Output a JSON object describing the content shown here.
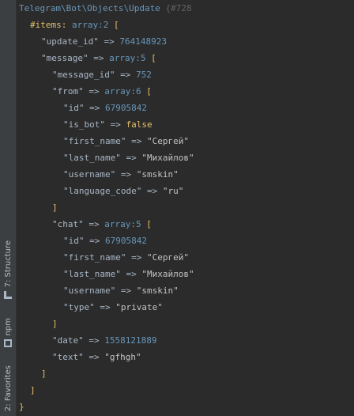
{
  "sidebar": {
    "structure": "7: Structure",
    "npm": "npm",
    "favorites": "2: Favorites"
  },
  "dump": {
    "class_name": "Telegram\\Bot\\Objects\\Update",
    "object_ref": "{#728",
    "items_label": "#items:",
    "items_type": "array:2",
    "update_id_key": "\"update_id\"",
    "update_id_val": "764148923",
    "message_key": "\"message\"",
    "message_type": "array:5",
    "message_id_key": "\"message_id\"",
    "message_id_val": "752",
    "from_key": "\"from\"",
    "from_type": "array:6",
    "from_id_key": "\"id\"",
    "from_id_val": "67905842",
    "is_bot_key": "\"is_bot\"",
    "is_bot_val": "false",
    "from_first_name_key": "\"first_name\"",
    "from_first_name_val": "\"Сергей\"",
    "from_last_name_key": "\"last_name\"",
    "from_last_name_val": "\"Михайлов\"",
    "from_username_key": "\"username\"",
    "from_username_val": "\"smskin\"",
    "language_code_key": "\"language_code\"",
    "language_code_val": "\"ru\"",
    "chat_key": "\"chat\"",
    "chat_type": "array:5",
    "chat_id_key": "\"id\"",
    "chat_id_val": "67905842",
    "chat_first_name_key": "\"first_name\"",
    "chat_first_name_val": "\"Сергей\"",
    "chat_last_name_key": "\"last_name\"",
    "chat_last_name_val": "\"Михайлов\"",
    "chat_username_key": "\"username\"",
    "chat_username_val": "\"smskin\"",
    "chat_kind_key": "\"type\"",
    "chat_kind_val": "\"private\"",
    "date_key": "\"date\"",
    "date_val": "1558121889",
    "text_key": "\"text\"",
    "text_val": "\"gfhgh\"",
    "arrow": "=>",
    "open_bracket": "[",
    "close_bracket": "]",
    "close_brace": "}"
  }
}
